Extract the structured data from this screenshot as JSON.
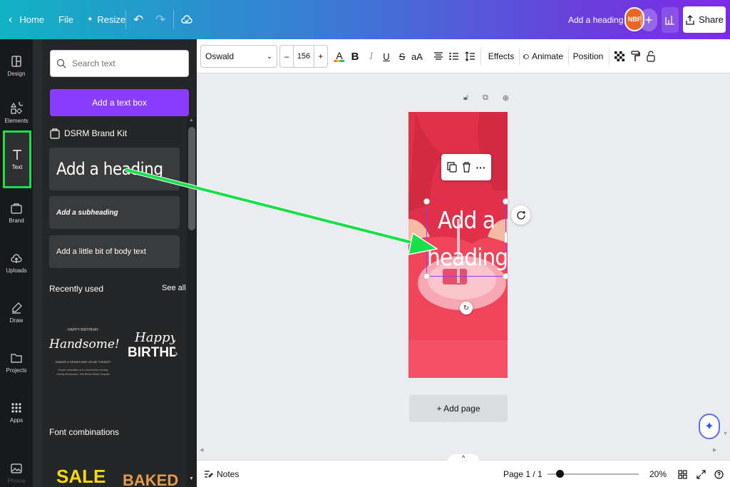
{
  "topbar": {
    "home": "Home",
    "file": "File",
    "resize": "Resize",
    "doc_title": "Add a heading",
    "avatar_initials": "NBF",
    "share": "Share"
  },
  "rail": {
    "items": [
      {
        "label": "Design",
        "icon": "design-icon"
      },
      {
        "label": "Elements",
        "icon": "elements-icon"
      },
      {
        "label": "Text",
        "icon": "text-icon"
      },
      {
        "label": "Brand",
        "icon": "brand-icon"
      },
      {
        "label": "Uploads",
        "icon": "uploads-icon"
      },
      {
        "label": "Draw",
        "icon": "draw-icon"
      },
      {
        "label": "Projects",
        "icon": "projects-icon"
      },
      {
        "label": "Apps",
        "icon": "apps-icon"
      },
      {
        "label": "Photos",
        "icon": "photos-icon"
      }
    ]
  },
  "panel": {
    "search_placeholder": "Search text",
    "add_text_box": "Add a text box",
    "brand_kit": "DSRM Brand Kit",
    "heading": "Add a heading",
    "subheading": "Add a subheading",
    "body": "Add a little bit of body text",
    "recently_used": "Recently used",
    "see_all": "See all",
    "recent_card": {
      "top_line": "· HAPPY BIRTHDAY ·",
      "script": "Handsome!",
      "sub_line": "DINNER & DRINKS ARE ON ME TONIGHT",
      "fine_1": "Simple celebration at 8 o'clock in the evening",
      "fine_2": "Greedy Restaurant - 900 Beach Street, Hospital",
      "card2_script": "Happy",
      "card2_block": "BIRTHDA"
    },
    "font_combinations": "Font combinations",
    "combo_1": "SALE",
    "combo_2": "BAKED"
  },
  "toolbar": {
    "font": "Oswald",
    "size": "156",
    "minus": "–",
    "plus": "+",
    "effects": "Effects",
    "animate": "Animate",
    "position": "Position"
  },
  "canvas": {
    "heading_line1": "Add a",
    "heading_line2": "heading",
    "add_page": "+ Add page"
  },
  "bottombar": {
    "notes": "Notes",
    "page_indicator": "Page 1 / 1",
    "zoom": "20%",
    "zoom_level": 0.14
  },
  "colors": {
    "accent_purple": "#8b3dff",
    "highlight_green": "#18e049",
    "page_red": "#f1455c"
  }
}
